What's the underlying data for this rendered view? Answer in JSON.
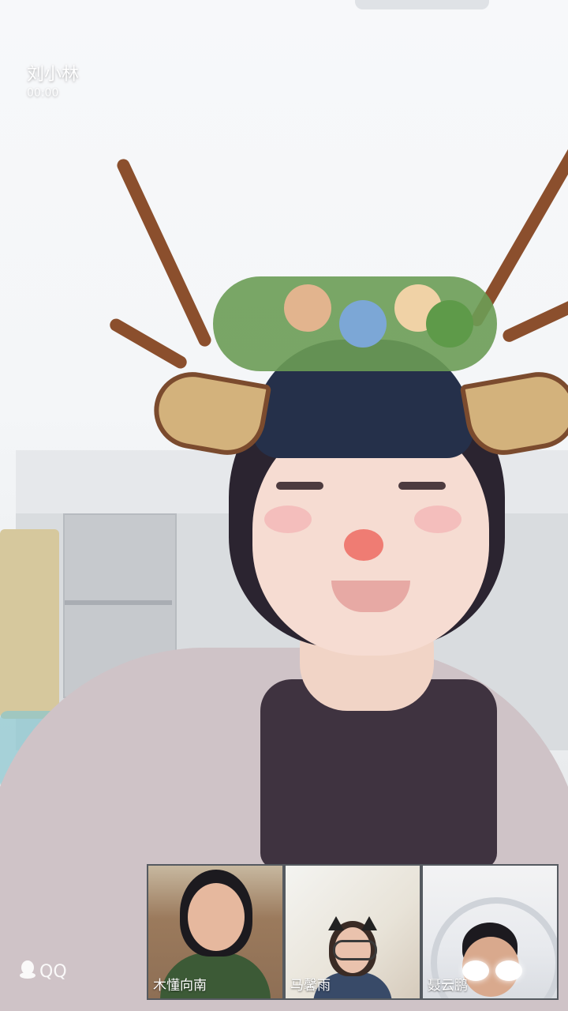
{
  "call": {
    "caller_name": "刘小林",
    "duration": "00:00"
  },
  "participants": [
    {
      "name": "木懂向南"
    },
    {
      "name": "马馨雨"
    },
    {
      "name": "聂云鹏"
    }
  ],
  "watermark": {
    "icon": "qq-penguin-icon",
    "text": "QQ"
  },
  "colors": {
    "thumb_border": "#555a60",
    "name_text": "#ffffff"
  }
}
